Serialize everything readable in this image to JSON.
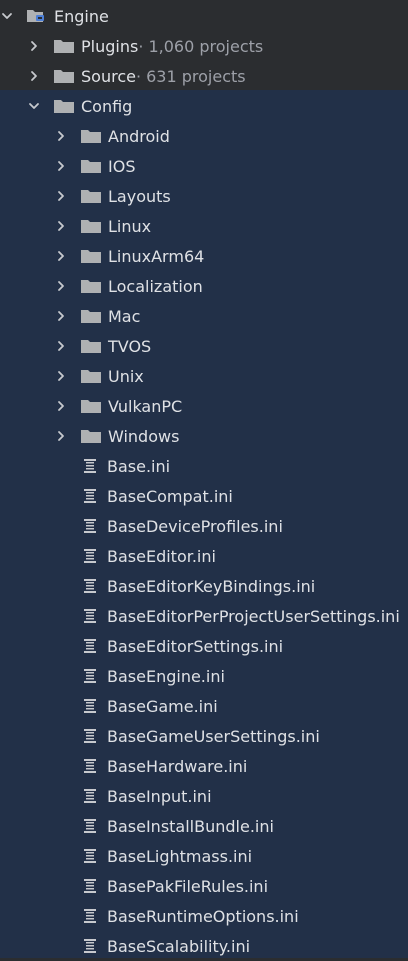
{
  "colors": {
    "background": "#2b2d30",
    "selection": "#223048",
    "text": "#dfe1e5",
    "muted_text": "#9da0a8",
    "folder_icon": "#afb1b3"
  },
  "tree": {
    "root": {
      "label": "Engine",
      "expanded": true,
      "icon": "engine-module-icon"
    },
    "top_folders": [
      {
        "label": "Plugins",
        "meta": " · 1,060 projects",
        "expanded": false,
        "icon": "folder-icon"
      },
      {
        "label": "Source",
        "meta": " · 631 projects",
        "expanded": false,
        "icon": "folder-icon"
      }
    ],
    "config": {
      "label": "Config",
      "expanded": true,
      "icon": "folder-icon"
    },
    "config_folders": [
      {
        "label": "Android"
      },
      {
        "label": "IOS"
      },
      {
        "label": "Layouts"
      },
      {
        "label": "Linux"
      },
      {
        "label": "LinuxArm64"
      },
      {
        "label": "Localization"
      },
      {
        "label": "Mac"
      },
      {
        "label": "TVOS"
      },
      {
        "label": "Unix"
      },
      {
        "label": "VulkanPC"
      },
      {
        "label": "Windows"
      }
    ],
    "config_files": [
      {
        "label": "Base.ini"
      },
      {
        "label": "BaseCompat.ini"
      },
      {
        "label": "BaseDeviceProfiles.ini"
      },
      {
        "label": "BaseEditor.ini"
      },
      {
        "label": "BaseEditorKeyBindings.ini"
      },
      {
        "label": "BaseEditorPerProjectUserSettings.ini"
      },
      {
        "label": "BaseEditorSettings.ini"
      },
      {
        "label": "BaseEngine.ini"
      },
      {
        "label": "BaseGame.ini"
      },
      {
        "label": "BaseGameUserSettings.ini"
      },
      {
        "label": "BaseHardware.ini"
      },
      {
        "label": "BaseInput.ini"
      },
      {
        "label": "BaseInstallBundle.ini"
      },
      {
        "label": "BaseLightmass.ini"
      },
      {
        "label": "BasePakFileRules.ini"
      },
      {
        "label": "BaseRuntimeOptions.ini"
      },
      {
        "label": "BaseScalability.ini"
      }
    ]
  }
}
